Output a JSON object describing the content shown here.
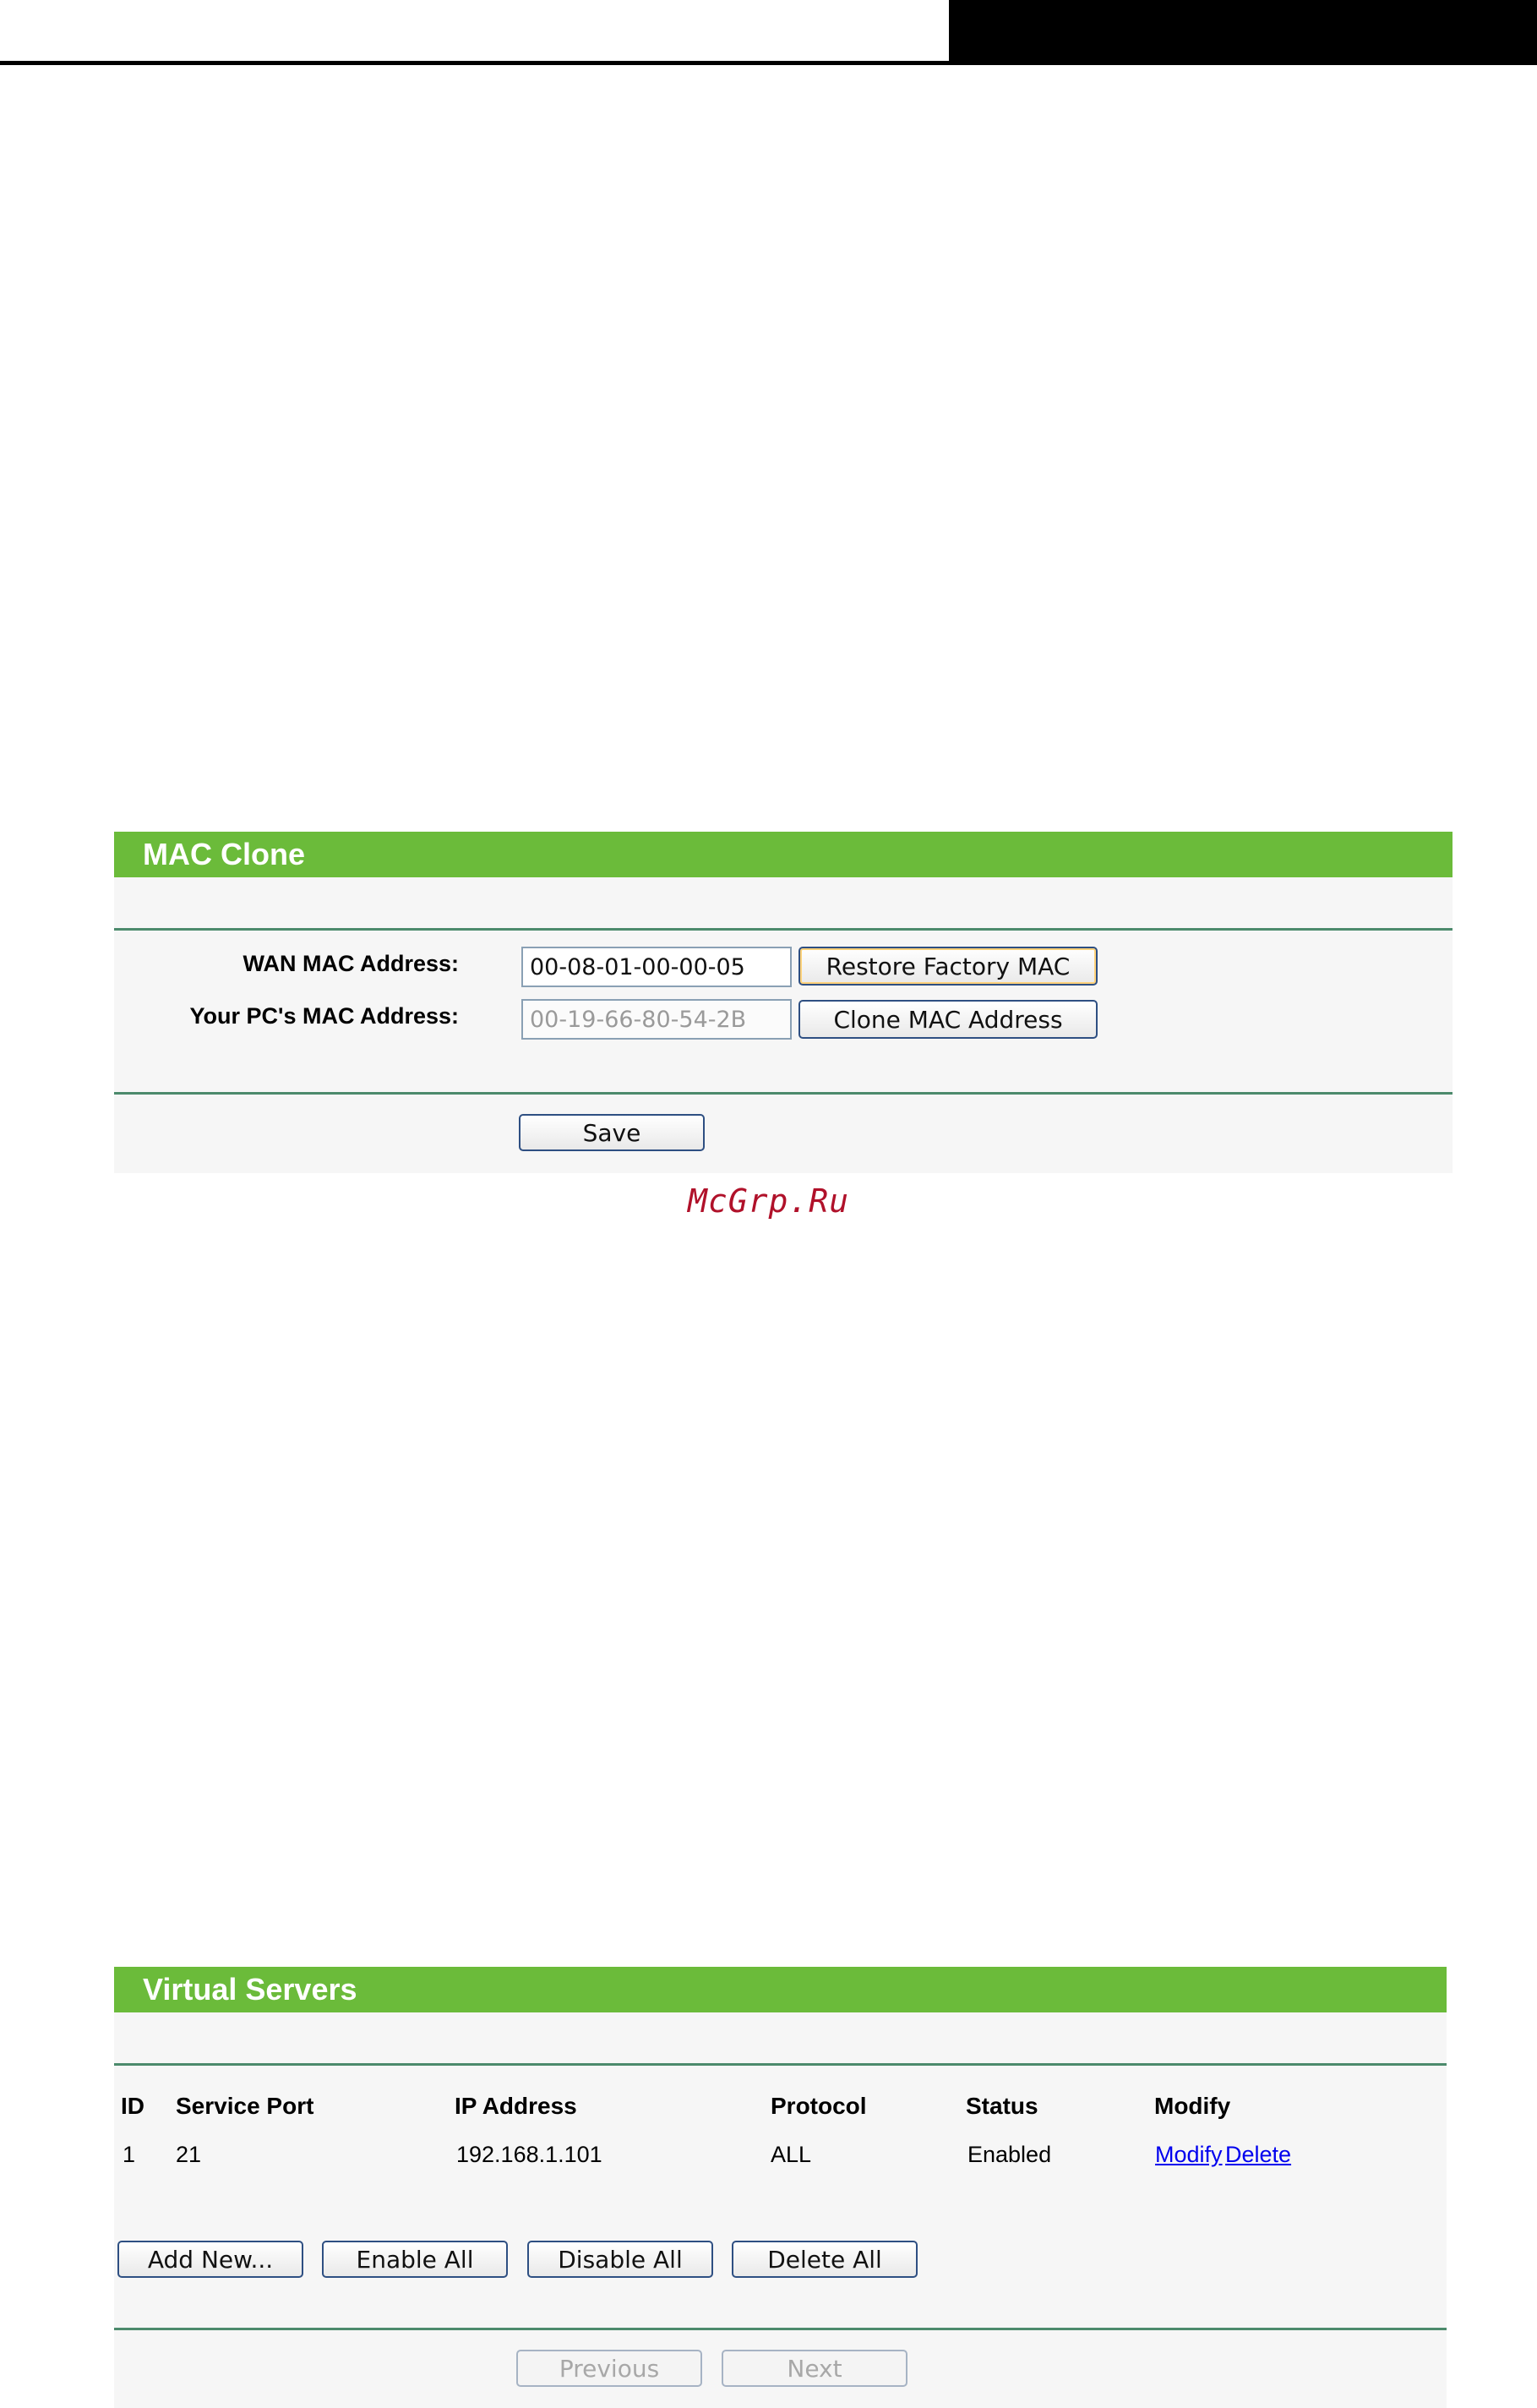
{
  "mac_clone": {
    "title": "MAC Clone",
    "wan_mac_label": "WAN MAC Address:",
    "wan_mac_value": "00-08-01-00-00-05",
    "restore_button": "Restore Factory MAC",
    "pc_mac_label": "Your PC's MAC Address:",
    "pc_mac_value": "00-19-66-80-54-2B",
    "clone_button": "Clone MAC Address",
    "save_button": "Save"
  },
  "watermark": "McGrp.Ru",
  "virtual_servers": {
    "title": "Virtual Servers",
    "columns": [
      "ID",
      "Service Port",
      "IP Address",
      "Protocol",
      "Status",
      "Modify"
    ],
    "rows": [
      {
        "id": "1",
        "service_port": "21",
        "ip_address": "192.168.1.101",
        "protocol": "ALL",
        "status": "Enabled",
        "modify_link": "Modify",
        "delete_link": "Delete"
      }
    ],
    "add_new_button": "Add New...",
    "enable_all_button": "Enable All",
    "disable_all_button": "Disable All",
    "delete_all_button": "Delete All",
    "previous_button": "Previous",
    "next_button": "Next"
  },
  "colors": {
    "title_bar": "#6bbb3a",
    "rule": "#4c8a6c",
    "watermark": "#b0112a",
    "link": "#0000ee"
  }
}
